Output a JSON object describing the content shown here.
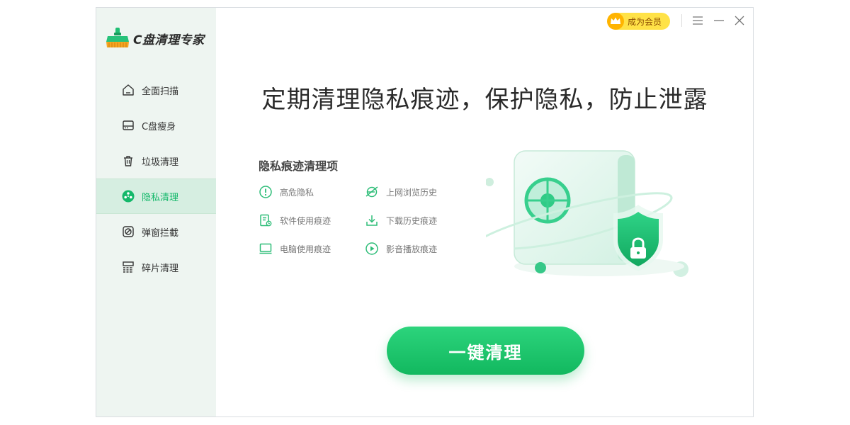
{
  "app": {
    "title": "C盘清理专家"
  },
  "colors": {
    "accent": "#14b86a",
    "sidebar_bg": "#eef5f1",
    "vip_bg": "#ffe247"
  },
  "sidebar": {
    "items": [
      {
        "label": "全面扫描",
        "icon": "home-icon",
        "active": false
      },
      {
        "label": "C盘瘦身",
        "icon": "disk-icon",
        "active": false
      },
      {
        "label": "垃圾清理",
        "icon": "trash-icon",
        "active": false
      },
      {
        "label": "隐私清理",
        "icon": "privacy-icon",
        "active": true
      },
      {
        "label": "弹窗拦截",
        "icon": "block-icon",
        "active": false
      },
      {
        "label": "碎片清理",
        "icon": "fragment-icon",
        "active": false
      }
    ]
  },
  "titlebar": {
    "vip_label": "成为会员",
    "menu_icon": "menu-icon",
    "minimize_icon": "minimize-icon",
    "close_icon": "close-icon"
  },
  "main": {
    "headline": "定期清理隐私痕迹，保护隐私，防止泄露",
    "section_title": "隐私痕迹清理项",
    "items": [
      {
        "label": "高危隐私",
        "icon": "alert-icon"
      },
      {
        "label": "上网浏览历史",
        "icon": "browser-icon"
      },
      {
        "label": "软件使用痕迹",
        "icon": "software-icon"
      },
      {
        "label": "下载历史痕迹",
        "icon": "download-icon"
      },
      {
        "label": "电脑使用痕迹",
        "icon": "computer-icon"
      },
      {
        "label": "影音播放痕迹",
        "icon": "play-icon"
      }
    ],
    "clean_button": "一键清理"
  }
}
